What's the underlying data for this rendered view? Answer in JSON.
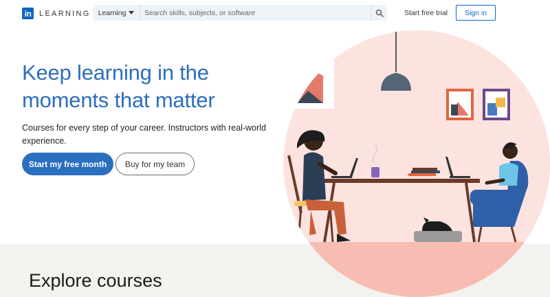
{
  "header": {
    "logo_mark": "in",
    "logo_text": "LEARNING",
    "search": {
      "category": "Learning",
      "placeholder": "Search skills, subjects, or software"
    },
    "start_trial": "Start free trial",
    "sign_in": "Sign in"
  },
  "hero": {
    "title": "Keep learning in the moments that matter",
    "subtitle": "Courses for every step of your career. Instructors with real-world experience.",
    "primary_cta": "Start my free month",
    "secondary_cta": "Buy for my team"
  },
  "explore": {
    "title": "Explore courses"
  },
  "colors": {
    "brand": "#0a66c2",
    "hero_title": "#2c6ebd",
    "illustration_bg": "#fde3df",
    "floor": "#f7bdb2",
    "bottom_band": "#f3f2ef"
  },
  "icons": [
    "linkedin-logo-icon",
    "chevron-down-icon",
    "search-icon"
  ]
}
